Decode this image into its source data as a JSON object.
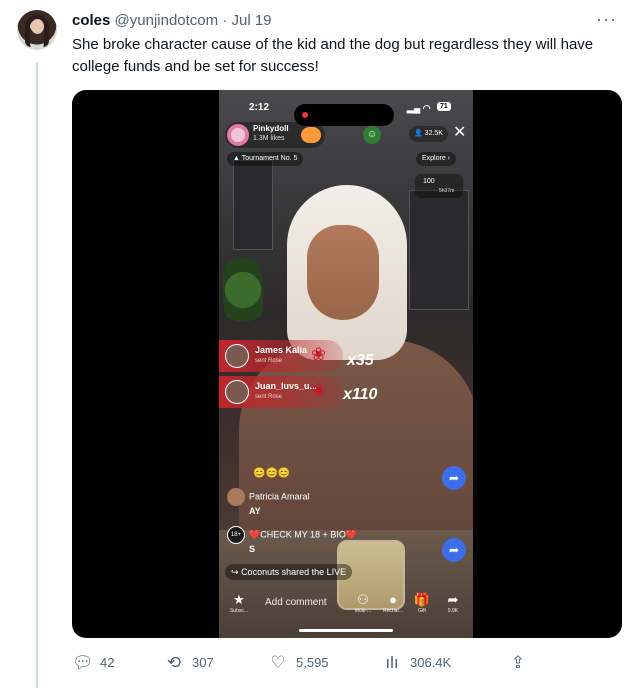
{
  "tweet": {
    "display_name": "coles",
    "handle": "@yunjindotcom",
    "separator": "·",
    "date": "Jul 19",
    "more_icon": "more-horizontal-icon",
    "text": "She broke character cause of the kid and the dog but regardless they will have college funds and be set for success!"
  },
  "video": {
    "status": {
      "time": "2:12",
      "battery": "71"
    },
    "host": {
      "name": "Pinkydoll",
      "likes": "1.3M likes"
    },
    "viewer_count": "32.5K",
    "tournament": "Tournament No. 5",
    "explore": "Explore",
    "gift_score": {
      "value": "100",
      "timer": "5h37m"
    },
    "gifts": [
      {
        "user": "James Kalia",
        "action": "sent Rose",
        "multiplier": "x35"
      },
      {
        "user": "Juan_luvs_u...",
        "action": "sent Rose",
        "multiplier": "x110"
      }
    ],
    "comments": [
      {
        "user": "Patricia Amaral",
        "text": "AY"
      },
      {
        "user": "❤️CHECK MY 18 + BIO❤️",
        "text": "S",
        "badge": "18+"
      }
    ],
    "shared_live": {
      "user": "Coconuts",
      "text": "shared the LIVE"
    },
    "bottom_bar": {
      "add_comment": "Add comment",
      "items": [
        {
          "label": "Subsc...",
          "icon": "star-icon"
        },
        {
          "label": "Multi-...",
          "icon": "multi-guest-icon"
        },
        {
          "label": "Rechar...",
          "icon": "coin-icon"
        },
        {
          "label": "Gift",
          "icon": "gift-icon"
        },
        {
          "label": "9.9K",
          "icon": "share-icon"
        }
      ]
    }
  },
  "stats": {
    "replies": "42",
    "reposts": "307",
    "likes": "5,595",
    "views": "306.4K"
  }
}
